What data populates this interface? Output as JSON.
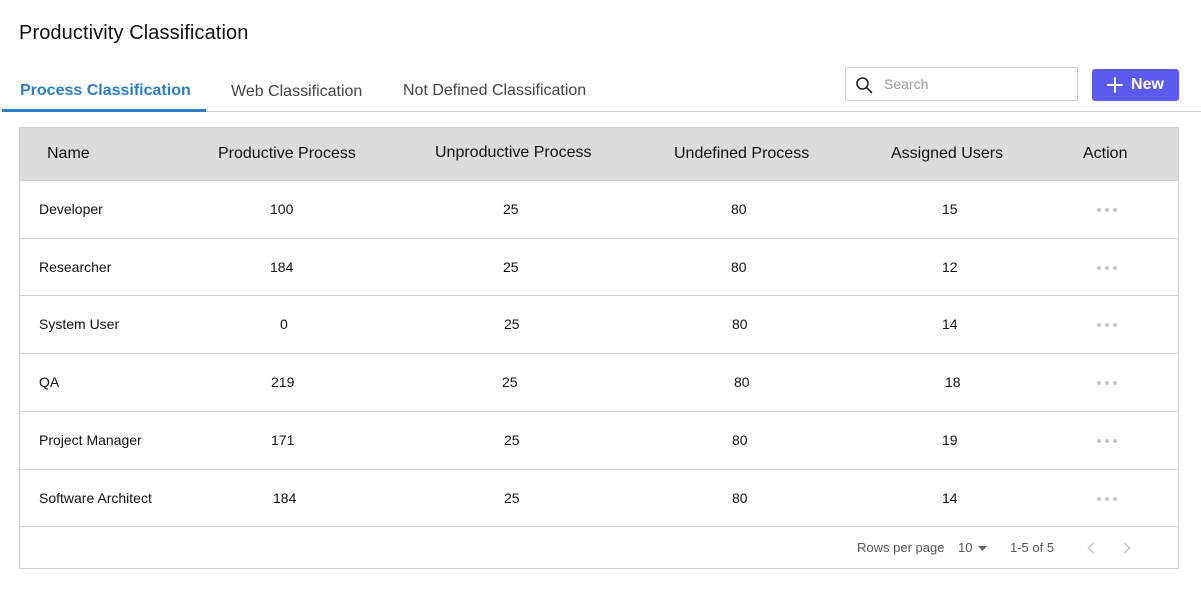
{
  "page": {
    "title": "Productivity Classification"
  },
  "tabs": [
    {
      "label": "Process Classification",
      "active": true
    },
    {
      "label": "Web Classification",
      "active": false
    },
    {
      "label": "Not Defined Classification",
      "active": false
    }
  ],
  "search": {
    "placeholder": "Search",
    "value": "",
    "icon": "search-icon"
  },
  "new_button": {
    "label": "New",
    "icon": "plus-icon",
    "color": "#5b5bef"
  },
  "accent_color": "#2e7dc6",
  "table": {
    "columns": [
      "Name",
      "Productive Process",
      "Unproductive Process",
      "Undefined Process",
      "Assigned Users",
      "Action"
    ],
    "rows": [
      {
        "name": "Developer",
        "productive": "100",
        "unproductive": "25",
        "undefined": "80",
        "users": "15"
      },
      {
        "name": "Researcher",
        "productive": "184",
        "unproductive": "25",
        "undefined": "80",
        "users": "12"
      },
      {
        "name": "System User",
        "productive": "0",
        "unproductive": "25",
        "undefined": "80",
        "users": "14"
      },
      {
        "name": "QA",
        "productive": "219",
        "unproductive": "25",
        "undefined": "80",
        "users": "18"
      },
      {
        "name": "Project Manager",
        "productive": "171",
        "unproductive": "25",
        "undefined": "80",
        "users": "19"
      },
      {
        "name": "Software Architect",
        "productive": "184",
        "unproductive": "25",
        "undefined": "80",
        "users": "14"
      }
    ],
    "action_icon": "more-horizontal-icon"
  },
  "pagination": {
    "rows_per_page_label": "Rows per page",
    "rows_per_page_value": "10",
    "range_text": "1-5 of 5",
    "prev_icon": "chevron-left-icon",
    "next_icon": "chevron-right-icon"
  }
}
